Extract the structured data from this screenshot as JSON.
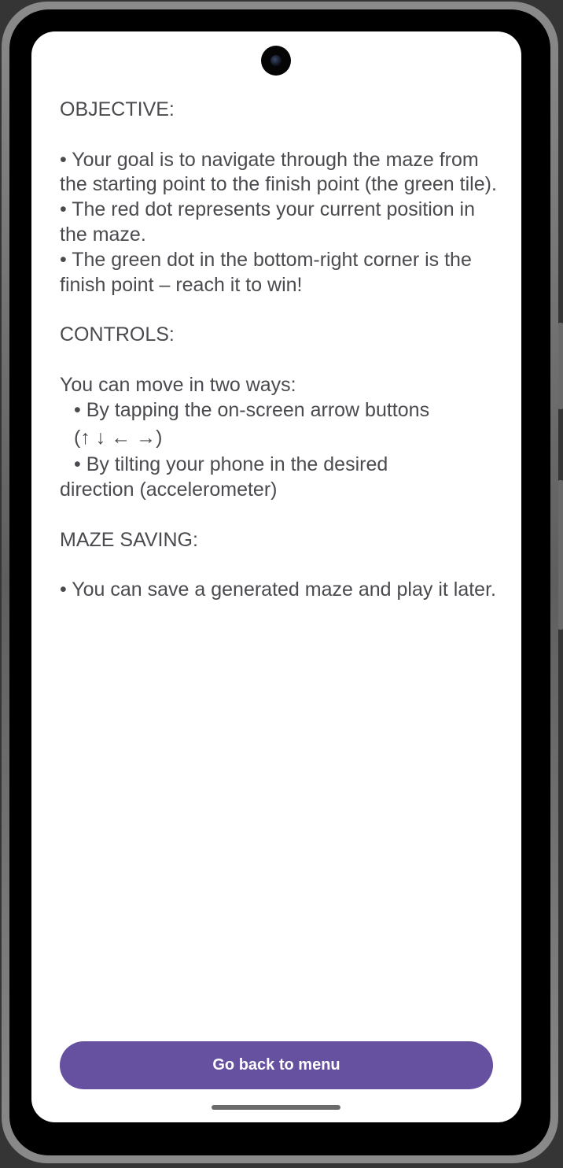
{
  "help": {
    "objective_heading": "OBJECTIVE:",
    "objective_1": "• Your goal is to navigate through the maze from the starting point to the finish point (the green tile).",
    "objective_2": "• The red dot represents your current position in the maze.",
    "objective_3": "• The green dot in the bottom-right corner is the finish point – reach it to win!",
    "controls_heading": "CONTROLS:",
    "controls_intro": "You can move in two ways:",
    "controls_1a": "• By tapping the on-screen arrow buttons",
    "controls_1b": "(↑ ↓ ← →)",
    "controls_2a": "• By tilting your phone in the desired",
    "controls_2b": "direction (accelerometer)",
    "saving_heading": "MAZE SAVING:",
    "saving_1": "• You can save a generated maze and play it later."
  },
  "footer": {
    "back_button_label": "Go back to menu"
  },
  "colors": {
    "accent": "#6650a0",
    "text": "#4a4a4f",
    "screen_background": "#ffffff"
  }
}
